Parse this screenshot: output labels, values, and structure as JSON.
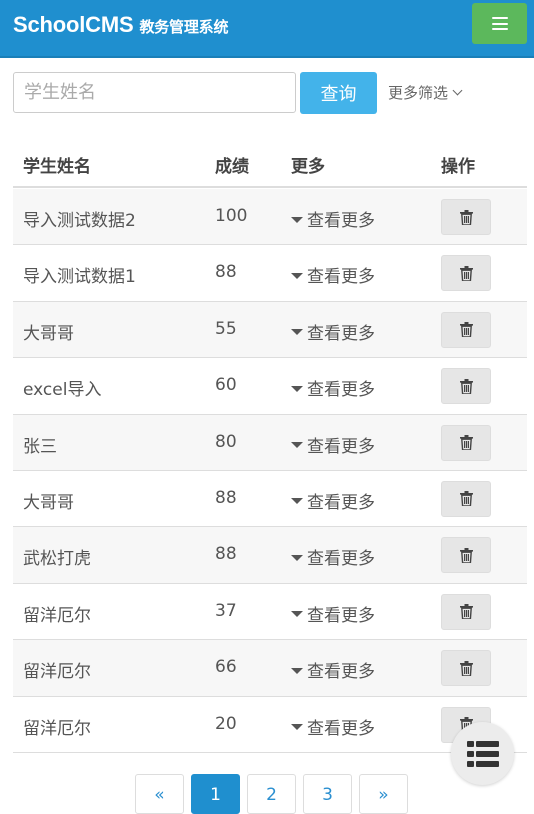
{
  "app": {
    "brand": "SchoolCMS",
    "subtitle": "教务管理系统"
  },
  "search": {
    "placeholder": "学生姓名",
    "value": "",
    "button_label": "查询",
    "more_filter_label": "更多筛选"
  },
  "table": {
    "headers": [
      "学生姓名",
      "成绩",
      "更多",
      "操作"
    ],
    "more_label": "查看更多",
    "rows": [
      {
        "name": "导入测试数据2",
        "score": "100"
      },
      {
        "name": "导入测试数据1",
        "score": "88"
      },
      {
        "name": "大哥哥",
        "score": "55"
      },
      {
        "name": "excel导入",
        "score": "60"
      },
      {
        "name": "张三",
        "score": "80"
      },
      {
        "name": "大哥哥",
        "score": "88"
      },
      {
        "name": "武松打虎",
        "score": "88"
      },
      {
        "name": "留洋厄尔",
        "score": "37"
      },
      {
        "name": "留洋厄尔",
        "score": "66"
      },
      {
        "name": "留洋厄尔",
        "score": "20"
      }
    ]
  },
  "pagination": {
    "prev": "«",
    "pages": [
      "1",
      "2",
      "3"
    ],
    "current": "1",
    "next": "»"
  },
  "icons": {
    "menu": "hamburger-icon",
    "delete": "trash-icon",
    "fab": "list-icon",
    "dropdown": "chevron-down-icon",
    "more": "caret-down-icon"
  },
  "colors": {
    "header_bg": "#1f8fcf",
    "menu_btn": "#5cb85c",
    "search_btn": "#43b3ea",
    "stripe": "#f7f7f7"
  }
}
